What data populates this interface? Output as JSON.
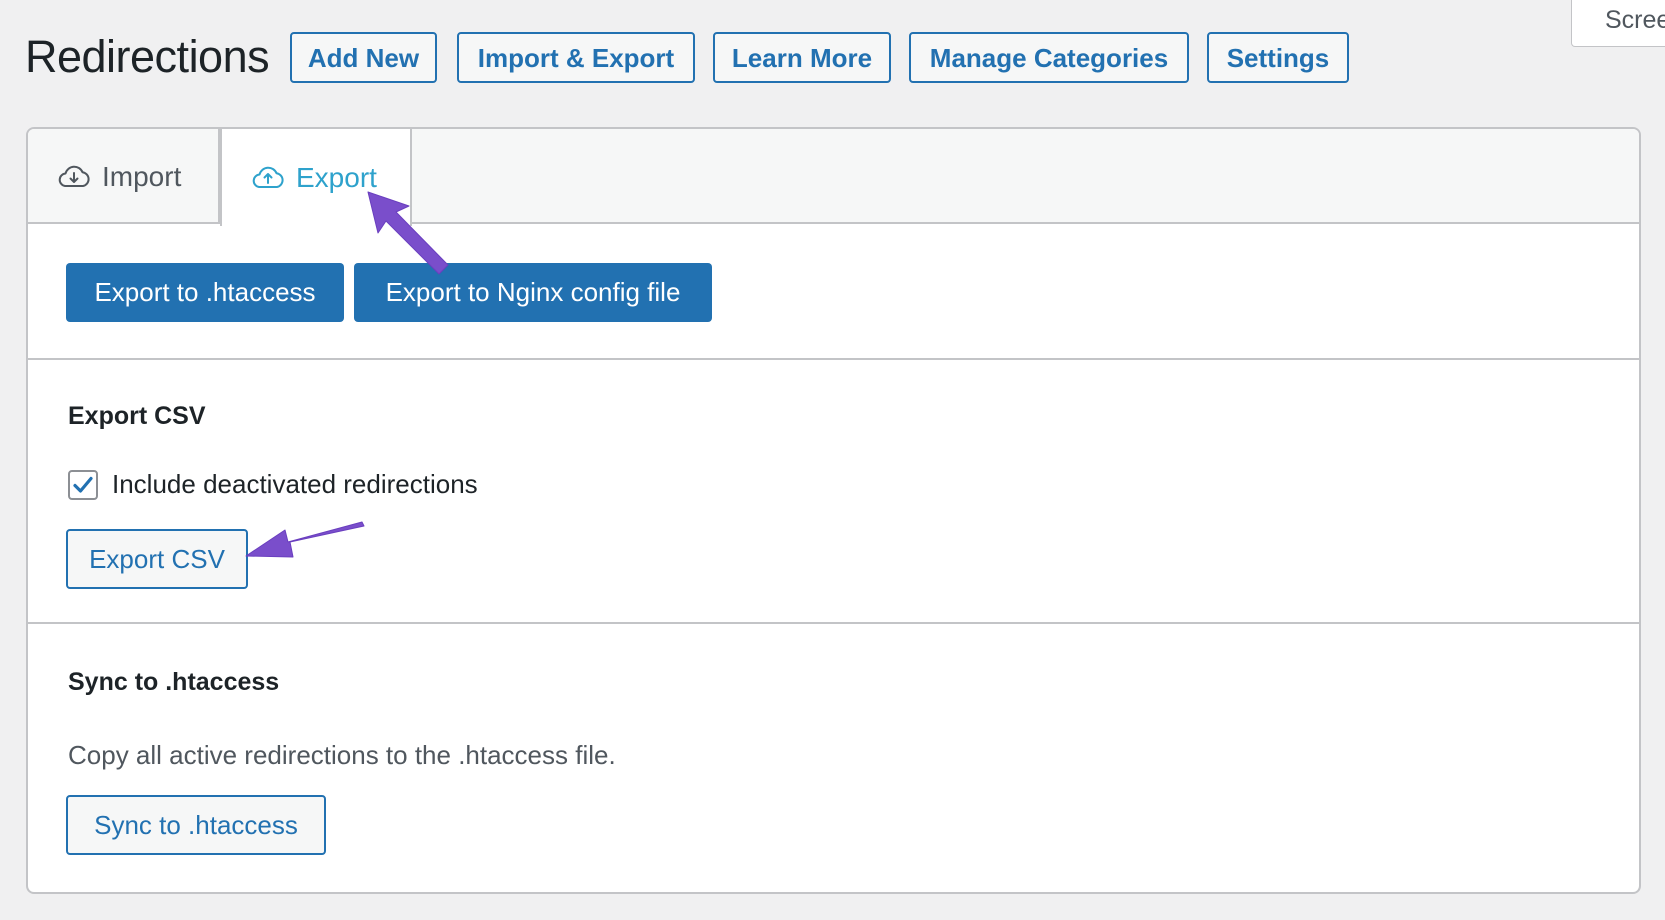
{
  "header": {
    "title": "Redirections",
    "screen_options_label": "Screen Options",
    "buttons": {
      "add_new": "Add New",
      "import_export": "Import & Export",
      "learn_more": "Learn More",
      "manage_categories": "Manage Categories",
      "settings": "Settings"
    }
  },
  "tabs": {
    "import": {
      "label": "Import",
      "icon": "cloud-download-icon"
    },
    "export": {
      "label": "Export",
      "icon": "cloud-upload-icon",
      "active": true
    }
  },
  "export_section": {
    "htaccess_button": "Export to .htaccess",
    "nginx_button": "Export to Nginx config file"
  },
  "csv_section": {
    "heading": "Export CSV",
    "checkbox_label": "Include deactivated redirections",
    "checkbox_checked": true,
    "button": "Export CSV"
  },
  "sync_section": {
    "heading": "Sync to .htaccess",
    "description": "Copy all active redirections to the .htaccess file.",
    "button": "Sync to .htaccess"
  },
  "colors": {
    "primary": "#2271b1",
    "active_tab": "#2ea2cc",
    "annotation_arrow": "#7a4ecb",
    "page_background": "#f0f0f1"
  }
}
